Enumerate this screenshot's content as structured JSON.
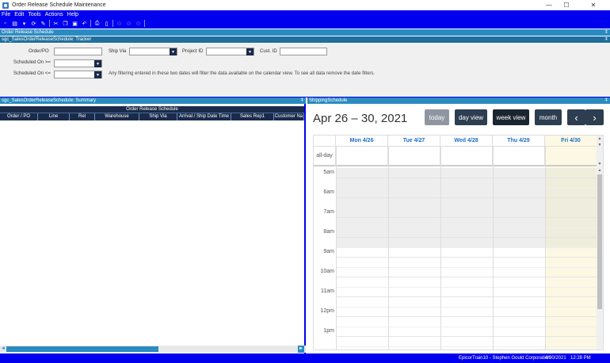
{
  "window": {
    "title": "Order Release Schedule Maintenance",
    "minimize_glyph": "—",
    "maximize_glyph": "☐",
    "close_glyph": "✕"
  },
  "menu": [
    "File",
    "Edit",
    "Tools",
    "Actions",
    "Help"
  ],
  "toolbar_icons": [
    "new-icon",
    "save-icon",
    "save-dropdown-icon",
    "refresh-icon",
    "clear-icon",
    "cut-icon",
    "copy-icon",
    "paste-icon",
    "undo-icon",
    "print-icon",
    "print-preview-icon",
    "attach-icon",
    "search-icon",
    "help-icon"
  ],
  "panels": {
    "main": "Order Release Schedule",
    "tracker": "sgc_SalesOrderReleaseSchedule: Tracker",
    "summary": "sgc_SalesOrderReleaseSchedule: Summary",
    "shipping": "ShippingSchedule",
    "pin": "ǂ"
  },
  "tracker": {
    "order_po_label": "Order/PO",
    "order_po_value": "",
    "ship_via_label": "Ship Via",
    "ship_via_value": "",
    "project_id_label": "Project ID",
    "project_id_value": "",
    "cust_id_label": "Cust. ID",
    "cust_id_value": "",
    "scheduled_from_label": "Scheduled On >=",
    "scheduled_from_value": "",
    "scheduled_to_label": "Scheduled On <=",
    "scheduled_to_value": "",
    "hint": "Any filtering entered in these two dates will filter the data available on the calendar view. To see all data remove the date filters.",
    "dropdown_glyph": "▼"
  },
  "summary_grid": {
    "group_header": "Order Release Schedule",
    "columns": [
      "Order / PO",
      "Line",
      "Rel",
      "Warehouse",
      "Ship Via",
      "Arrival / Ship Date Time",
      "Sales Rep1",
      "Customer Na"
    ],
    "rows": [],
    "scroll_left": "◄",
    "scroll_right": "►"
  },
  "calendar": {
    "title": "Apr 26 – 30, 2021",
    "buttons": {
      "today": "today",
      "day": "day view",
      "week": "week view",
      "month": "month",
      "prev": "‹",
      "next": "›"
    },
    "days": [
      "Mon 4/26",
      "Tue 4/27",
      "Wed 4/28",
      "Thu 4/29",
      "Fri 4/30"
    ],
    "all_day_label": "all-day",
    "hours": [
      "5am",
      "6am",
      "7am",
      "8am",
      "9am",
      "10am",
      "11am",
      "12pm",
      "1pm"
    ],
    "business_hours_start": "9am",
    "today": "Fri 4/30",
    "scroll_up": "▲",
    "scroll_down": "▼"
  },
  "status": {
    "user": "EpicorTrain10 - Stephen Gould Corporation",
    "date": "4/30/2021",
    "time": "12:28 PM"
  },
  "colors": {
    "chrome_blue": "#0000ee",
    "panel_header": "#2a8bc0",
    "grid_header": "#1a2b4a",
    "calendar_button": "#2c3e50",
    "day_header_text": "#1a6ec8",
    "today_highlight": "#fcf8e3"
  }
}
